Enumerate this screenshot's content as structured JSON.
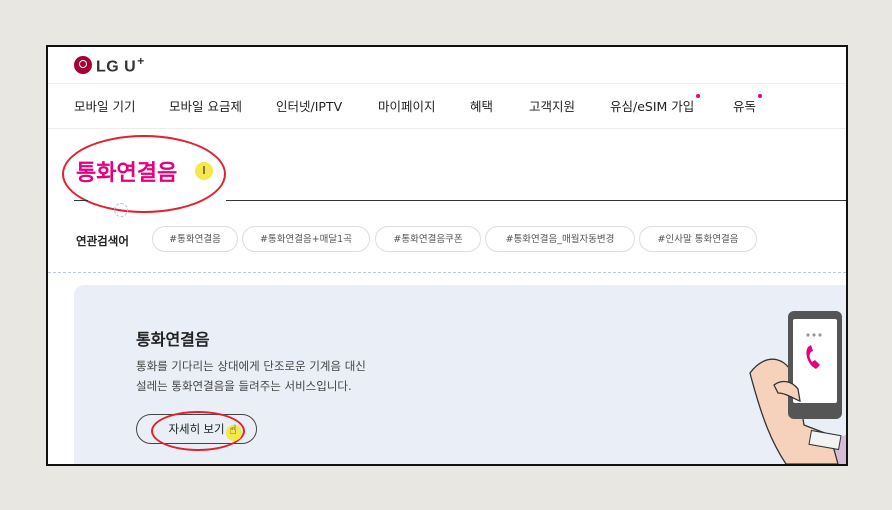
{
  "header": {
    "logo_text": "LG U",
    "logo_plus": "+"
  },
  "gnb": {
    "items": [
      {
        "label": "모바일 기기"
      },
      {
        "label": "모바일 요금제"
      },
      {
        "label": "인터넷/IPTV"
      },
      {
        "label": "마이페이지"
      },
      {
        "label": "혜택"
      },
      {
        "label": "고객지원"
      },
      {
        "label": "유심/eSIM 가입"
      },
      {
        "label": "유독"
      }
    ]
  },
  "search": {
    "title": "통화연결음"
  },
  "related": {
    "label": "연관검색어",
    "chips": [
      "#통화연결음",
      "#통화연결음+매달1곡",
      "#통화연결음쿠폰",
      "#통화연결음_매월자동변경",
      "#인사말 통화연결음"
    ]
  },
  "banner": {
    "title": "통화연결음",
    "desc_line1": "통화를 기다리는 상대에게 단조로운 기계음 대신",
    "desc_line2": "설레는 통화연결음을 들려주는 서비스입니다.",
    "button_label": "자세히 보기"
  },
  "cursor": {
    "ibeam": "I"
  },
  "colors": {
    "brand": "#e6007e",
    "logo": "#a50034",
    "annotation": "#e3202e",
    "highlight": "#f4e84a"
  },
  "icons": [
    "lg-logo-icon",
    "notification-dot-icon",
    "text-cursor-icon",
    "hand-pointer-icon",
    "phone-call-icon"
  ]
}
